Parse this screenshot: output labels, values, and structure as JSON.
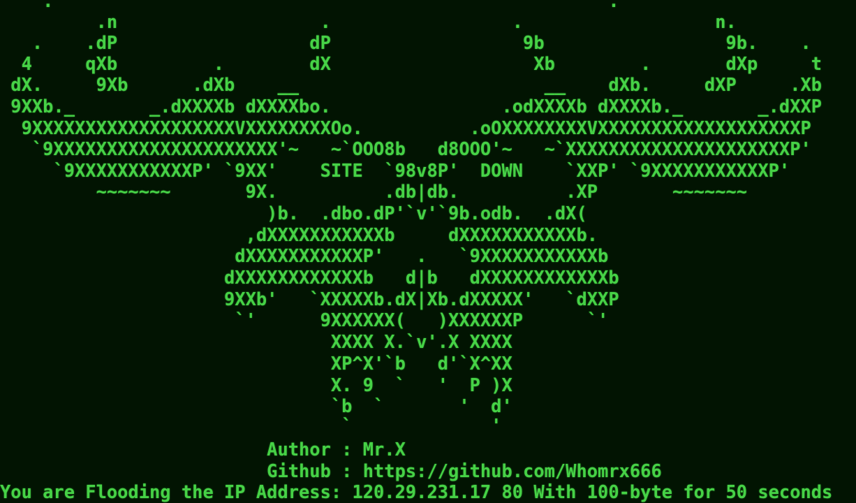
{
  "terminal": {
    "banner_lines": [
      "    .                                                    .",
      "         .n                   .                 .                  n.",
      "   .    .dP                  dP                  9b                 9b.    .",
      "  4     qXb         .        dX                   Xb        .       dXp     t",
      " dX.     9Xb      .dXb    __                       __    dXb.     dXP     .Xb",
      " 9XXb._       _.dXXXXb dXXXXbo.                .odXXXXb dXXXXb._       _.dXXP",
      "  9XXXXXXXXXXXXXXXXXXXVXXXXXXXXOo.          .oOXXXXXXXXVXXXXXXXXXXXXXXXXXXXP",
      "   `9XXXXXXXXXXXXXXXXXXXXX'~   ~`OOO8b   d8OOO'~   ~`XXXXXXXXXXXXXXXXXXXXXP'",
      "     `9XXXXXXXXXXXP' `9XX'    SITE  `98v8P'  DOWN    `XXP' `9XXXXXXXXXXXP'",
      "         ~~~~~~~       9X.          .db|db.          .XP       ~~~~~~~",
      "                         )b.  .dbo.dP'`v'`9b.odb.  .dX(",
      "                       ,dXXXXXXXXXXXb     dXXXXXXXXXXXb.",
      "                      dXXXXXXXXXXXP'   .   `9XXXXXXXXXXXb",
      "                     dXXXXXXXXXXXXb   d|b   dXXXXXXXXXXXXb",
      "                     9XXb'   `XXXXXb.dX|Xb.dXXXXX'   `dXXP",
      "                      `'      9XXXXXX(   )XXXXXXP      `'",
      "                               XXXX X.`v'.X XXXX",
      "                               XP^X'`b   d'`X^XX",
      "                               X. 9  `   '  P )X",
      "                               `b  `       '  d'",
      "                                `             '"
    ],
    "author_line": "                         Author : Mr.X",
    "github_line": "                         Github : https://github.com/Whomrx666",
    "status_line": "You are Flooding the IP Address: 120.29.231.17 80 With 100-byte for 50 seconds"
  },
  "colors": {
    "background": "#021402",
    "text": "#46d246"
  }
}
